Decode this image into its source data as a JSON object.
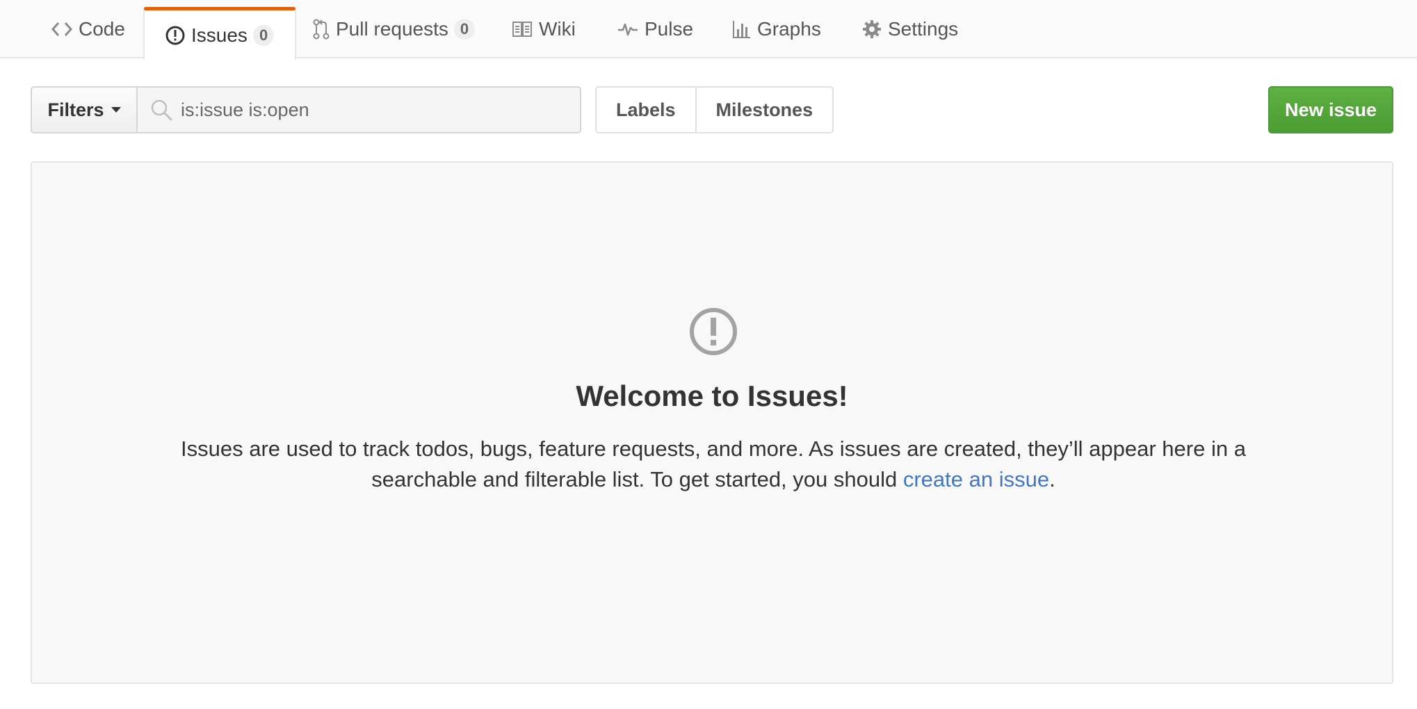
{
  "tabs": [
    {
      "label": "Code",
      "icon": "code-icon"
    },
    {
      "label": "Issues",
      "count": "0",
      "icon": "issue-opened-icon",
      "selected": true
    },
    {
      "label": "Pull requests",
      "count": "0",
      "icon": "git-pull-request-icon"
    },
    {
      "label": "Wiki",
      "icon": "book-icon"
    },
    {
      "label": "Pulse",
      "icon": "pulse-icon"
    },
    {
      "label": "Graphs",
      "icon": "graph-icon"
    },
    {
      "label": "Settings",
      "icon": "gear-icon"
    }
  ],
  "filters": {
    "button_label": "Filters",
    "search_value": "",
    "search_placeholder": "is:issue is:open"
  },
  "labels_label": "Labels",
  "milestones_label": "Milestones",
  "new_issue_label": "New issue",
  "blankslate": {
    "title": "Welcome to Issues!",
    "description_prefix": "Issues are used to track todos, bugs, feature requests, and more. As issues are created, they’ll appear here in a searchable and filterable list. To get started, you should ",
    "link_text": "create an issue",
    "description_suffix": "."
  },
  "colors": {
    "selected_tab_accent": "#e36209",
    "primary_button": "#55a532",
    "link": "#4078c0"
  }
}
